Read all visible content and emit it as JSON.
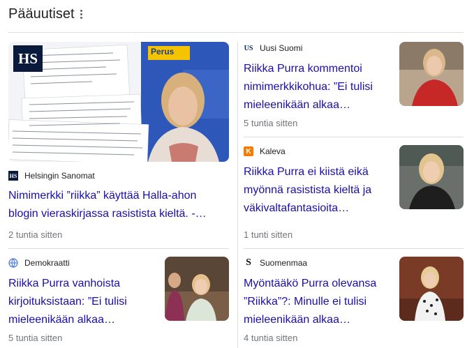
{
  "section": {
    "title": "Pääuutiset"
  },
  "big_story": {
    "source": "Helsingin Sanomat",
    "source_icon": "hs-favicon",
    "headline": "Nimimerkki ”riikka” käyttää Halla-ahon blogin vieraskirjassa rasistista kieltä. -…",
    "time": "2 tuntia sitten",
    "image_badge": "HS",
    "banner_text": "Perus"
  },
  "stories": [
    {
      "source": "Uusi Suomi",
      "source_icon": "us-favicon",
      "favicon_text": "US",
      "headline": "Riikka Purra kommentoi nimimerkkikohua: ”Ei tulisi mieleenikään alkaa…",
      "time": "5 tuntia sitten"
    },
    {
      "source": "Kaleva",
      "source_icon": "kaleva-favicon",
      "favicon_text": "K",
      "headline": "Riikka Purra ei kiistä eikä myönnä rasistista kieltä ja väkivaltafantasioita…",
      "time": "1 tunti sitten"
    },
    {
      "source": "Demokraatti",
      "source_icon": "globe-favicon",
      "favicon_text": "",
      "headline": "Riikka Purra vanhoista kirjoituksistaan: ”Ei tulisi mieleenikään alkaa…",
      "time": "5 tuntia sitten"
    },
    {
      "source": "Suomenmaa",
      "source_icon": "suomenmaa-favicon",
      "favicon_text": "S",
      "headline": "Myöntääkö Purra olevansa ”Riikka”?: Minulle ei tulisi mieleenikään alkaa…",
      "time": "4 tuntia sitten"
    }
  ],
  "colors": {
    "link": "#1a0dab",
    "meta": "#70757a",
    "divider": "#dadce0",
    "kaleva_orange": "#f57c00"
  }
}
